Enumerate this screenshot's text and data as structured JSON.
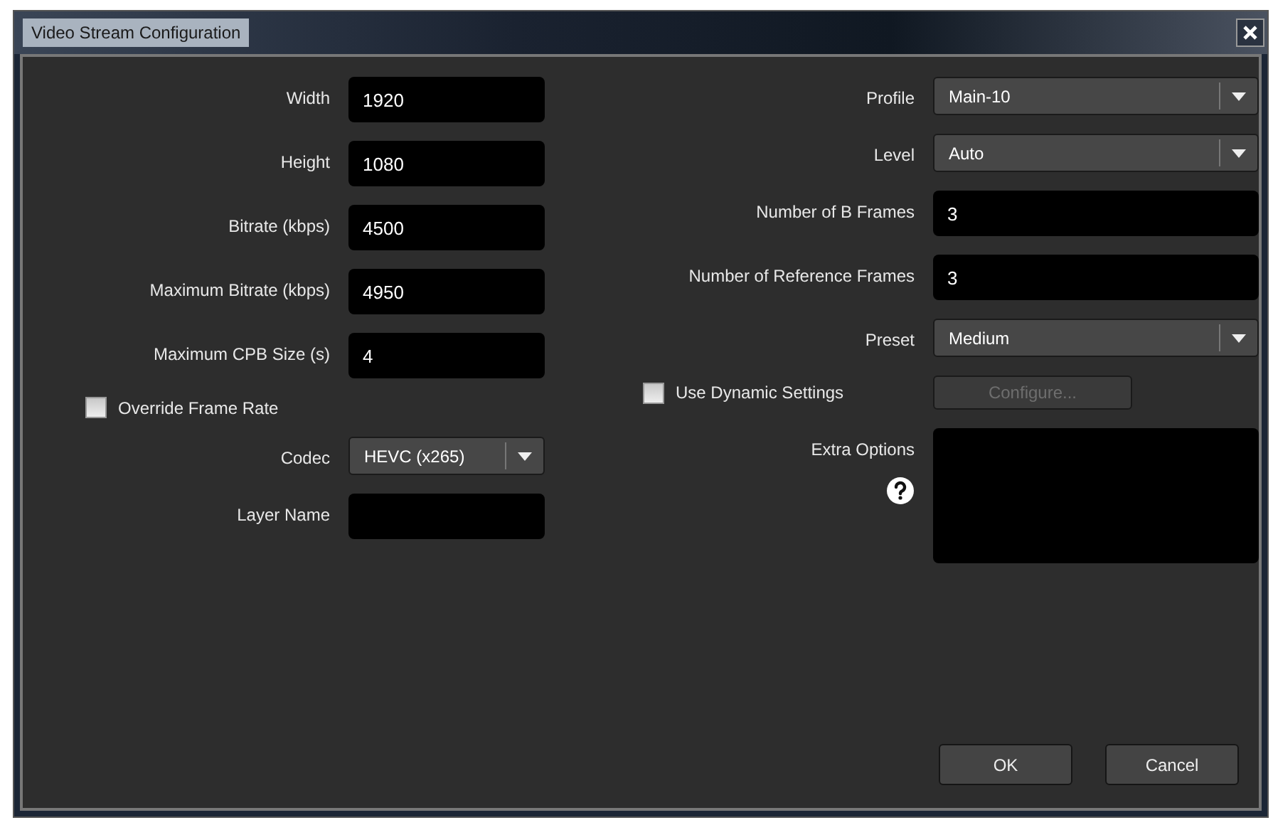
{
  "window": {
    "title": "Video Stream Configuration"
  },
  "left": [
    {
      "kind": "text",
      "label": "Width",
      "value": "1920"
    },
    {
      "kind": "text",
      "label": "Height",
      "value": "1080"
    },
    {
      "kind": "text",
      "label": "Bitrate (kbps)",
      "value": "4500"
    },
    {
      "kind": "text",
      "label": "Maximum Bitrate (kbps)",
      "value": "4950"
    },
    {
      "kind": "text",
      "label": "Maximum CPB Size (s)",
      "value": "4"
    },
    {
      "kind": "checkbox",
      "label": "Override Frame Rate",
      "checked": false
    },
    {
      "kind": "dropdown",
      "label": "Codec",
      "value": "HEVC (x265)"
    },
    {
      "kind": "text",
      "label": "Layer Name"
    }
  ],
  "right": [
    {
      "kind": "dropdown",
      "label": "Profile",
      "value": "Main-10"
    },
    {
      "kind": "dropdown",
      "label": "Level",
      "value": "Auto"
    },
    {
      "kind": "text",
      "label": "Number of B Frames",
      "value": "3"
    },
    {
      "kind": "text",
      "label": "Number of Reference Frames",
      "value": "3"
    },
    {
      "kind": "dropdown",
      "label": "Preset",
      "value": "Medium"
    },
    {
      "kind": "checkbox",
      "label": "Use Dynamic Settings",
      "checked": false,
      "button": {
        "label": "Configure...",
        "disabled": true
      }
    },
    {
      "kind": "textarea",
      "label": "Extra Options",
      "help": true
    }
  ],
  "buttons": [
    {
      "label": "OK"
    },
    {
      "label": "Cancel"
    }
  ]
}
